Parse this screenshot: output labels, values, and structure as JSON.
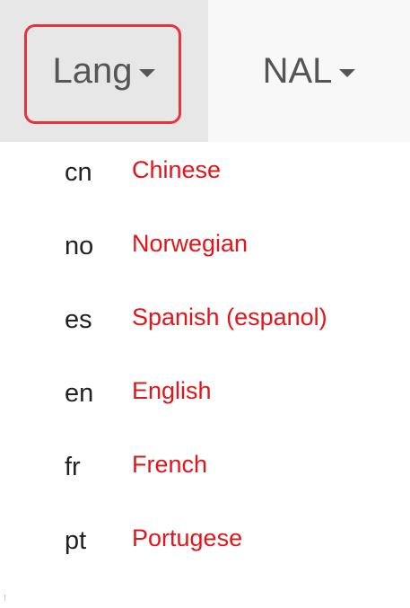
{
  "navbar": {
    "lang_label": "Lang",
    "nal_label": "NAL"
  },
  "language_menu": {
    "items": [
      {
        "code": "cn",
        "name": "Chinese"
      },
      {
        "code": "no",
        "name": "Norwegian"
      },
      {
        "code": "es",
        "name": "Spanish (espanol)"
      },
      {
        "code": "en",
        "name": "English"
      },
      {
        "code": "fr",
        "name": "French"
      },
      {
        "code": "pt",
        "name": "Portugese"
      }
    ]
  },
  "colors": {
    "link_red": "#e3141a",
    "highlight_border": "#e8323c",
    "active_tab_bg": "#e7e7e7",
    "navbar_bg": "#f8f8f8"
  },
  "icons": {
    "dropdown": "caret-down-icon"
  }
}
